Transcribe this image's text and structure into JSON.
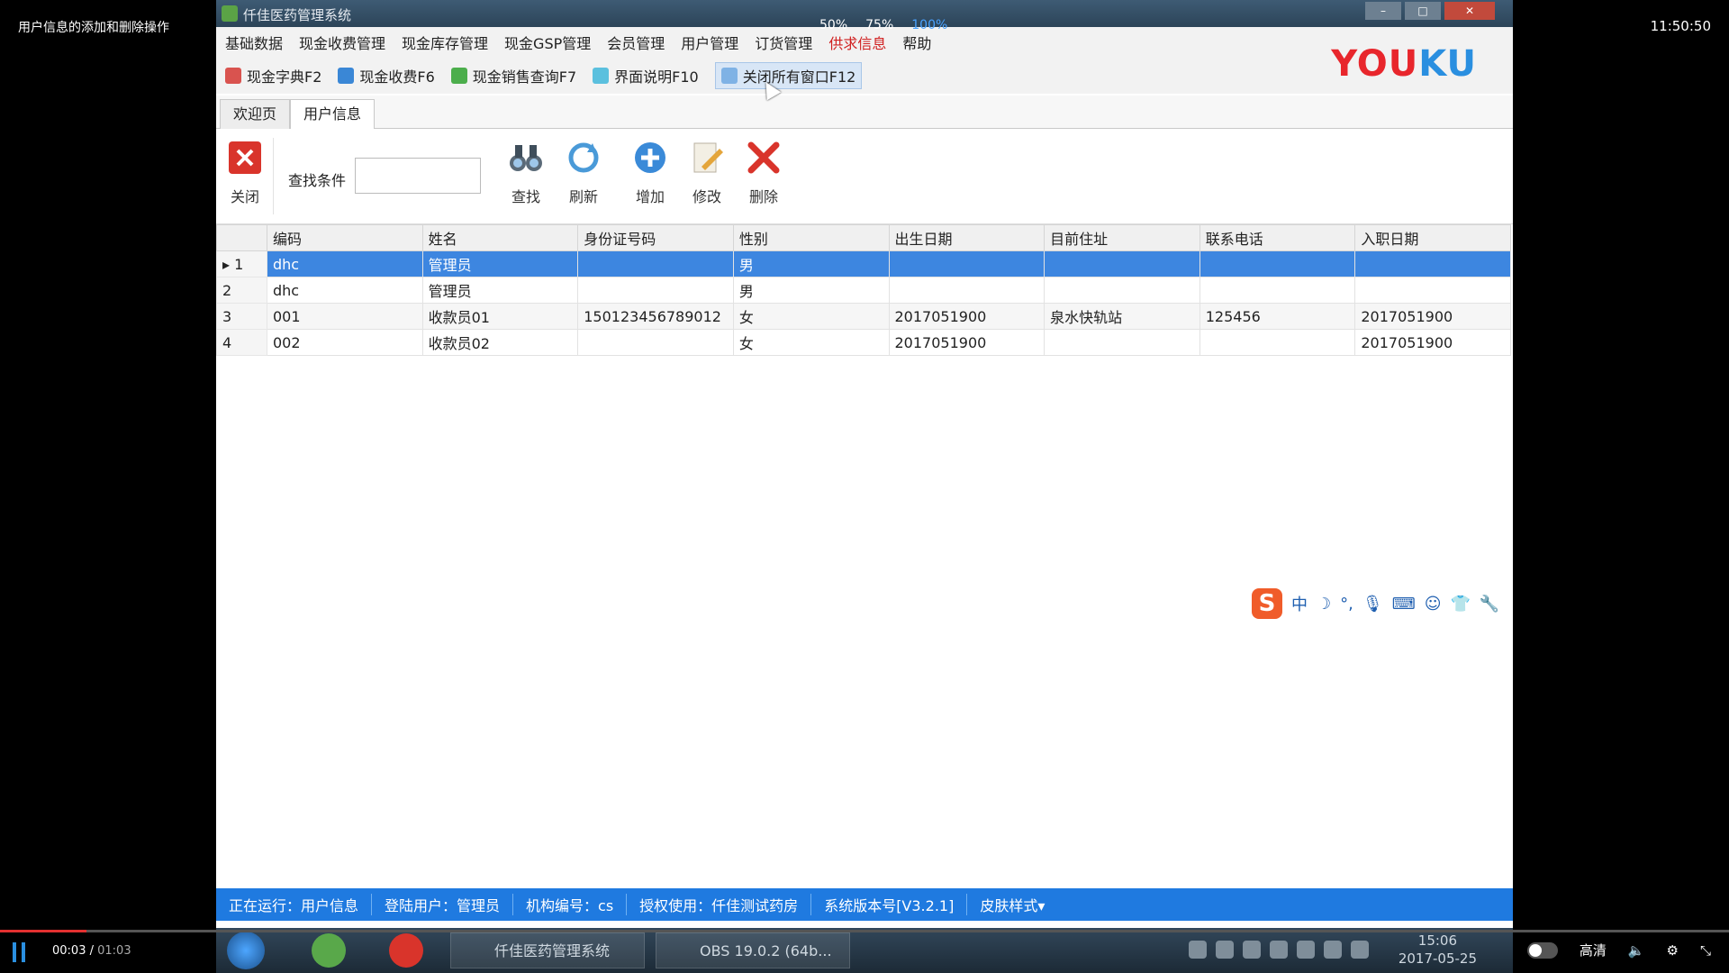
{
  "player": {
    "video_title": "用户信息的添加和删除操作",
    "clock": "11:50:50",
    "zoom_options": [
      "50%",
      "75%",
      "100%"
    ],
    "current_time": "00:03",
    "duration": "01:03",
    "progress_fraction": 0.05,
    "quality_label": "高清",
    "accent_color": "#2a8fe0"
  },
  "app": {
    "window_title": "仟佳医药管理系统",
    "logo_text": [
      "YOU",
      "KU"
    ],
    "menu": [
      "基础数据",
      "现金收费管理",
      "现金库存管理",
      "现金GSP管理",
      "会员管理",
      "用户管理",
      "订货管理",
      "供求信息",
      "帮助"
    ],
    "quick_buttons": [
      "现金字典F2",
      "现金收费F6",
      "现金销售查询F7",
      "界面说明F10",
      "关闭所有窗口F12"
    ],
    "tabs": [
      "欢迎页",
      "用户信息"
    ],
    "commands": {
      "close": "关闭",
      "search_label": "查找条件",
      "search_value": "",
      "find": "查找",
      "refresh": "刷新",
      "add": "增加",
      "edit": "修改",
      "delete": "删除"
    },
    "grid": {
      "columns": [
        "编码",
        "姓名",
        "身份证号码",
        "性别",
        "出生日期",
        "目前住址",
        "联系电话",
        "入职日期"
      ],
      "rows": [
        {
          "num": "1",
          "cells": [
            "dhc",
            "管理员",
            "",
            "男",
            "",
            "",
            "",
            ""
          ]
        },
        {
          "num": "2",
          "cells": [
            "dhc",
            "管理员",
            "",
            "男",
            "",
            "",
            "",
            ""
          ]
        },
        {
          "num": "3",
          "cells": [
            "001",
            "收款员01",
            "150123456789012",
            "女",
            "2017051900",
            "泉水快轨站",
            "125456",
            "2017051900"
          ]
        },
        {
          "num": "4",
          "cells": [
            "002",
            "收款员02",
            "",
            "女",
            "2017051900",
            "",
            "",
            "2017051900"
          ]
        }
      ],
      "selected_row": 0,
      "selection_color": "#3d86e0"
    },
    "ime_symbol": "中",
    "status": [
      "正在运行：用户信息",
      "登陆用户：管理员",
      "机构编号：cs",
      "授权使用：仟佳测试药房",
      "系统版本号[V3.2.1]",
      "皮肤样式▾"
    ],
    "status_color": "#1f7ae0"
  },
  "taskbar": {
    "apps": [
      "仟佳医药管理系统",
      "OBS 19.0.2 (64b..."
    ],
    "time": "15:06",
    "date": "2017-05-25"
  }
}
